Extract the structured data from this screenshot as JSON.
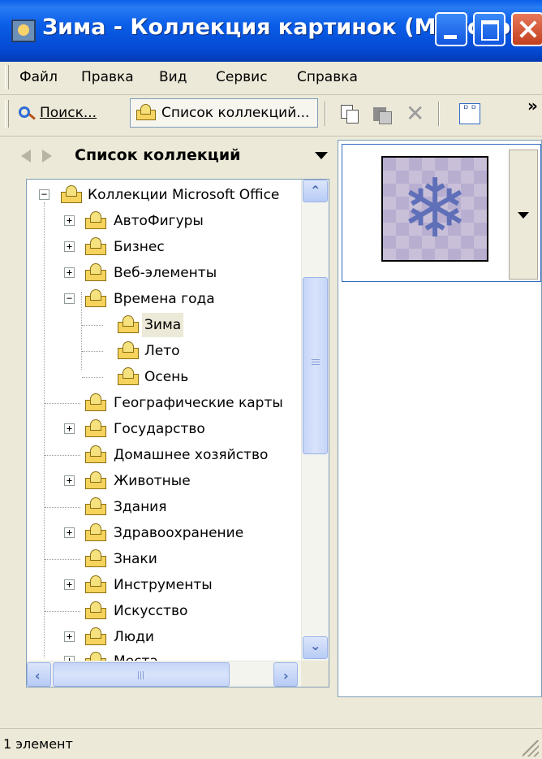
{
  "window": {
    "title": "Зима - Коллекция картинок (Microsoft)"
  },
  "menu": [
    {
      "label": "Файл"
    },
    {
      "label": "Правка"
    },
    {
      "label": "Вид"
    },
    {
      "label": "Сервис"
    },
    {
      "label": "Справка"
    }
  ],
  "toolbar": {
    "search_label": "Поиск...",
    "collection_list_label": "Список коллекций...",
    "more_chevron": "»",
    "layout_icon_text": "ᴰ ᴰ"
  },
  "left_pane": {
    "title": "Список коллекций",
    "tree": [
      {
        "label": "Коллекции Microsoft Office",
        "expander": "−"
      },
      {
        "label": "АвтоФигуры",
        "expander": "+"
      },
      {
        "label": "Бизнес",
        "expander": "+"
      },
      {
        "label": "Веб-элементы",
        "expander": "+"
      },
      {
        "label": "Времена года",
        "expander": "−"
      },
      {
        "label": "Зима",
        "expander": ""
      },
      {
        "label": "Лето",
        "expander": ""
      },
      {
        "label": "Осень",
        "expander": ""
      },
      {
        "label": "Географические карты",
        "expander": ""
      },
      {
        "label": "Государство",
        "expander": "+"
      },
      {
        "label": "Домашнее хозяйство",
        "expander": ""
      },
      {
        "label": "Животные",
        "expander": "+"
      },
      {
        "label": "Здания",
        "expander": ""
      },
      {
        "label": "Здравоохранение",
        "expander": "+"
      },
      {
        "label": "Знаки",
        "expander": ""
      },
      {
        "label": "Инструменты",
        "expander": "+"
      },
      {
        "label": "Искусство",
        "expander": ""
      },
      {
        "label": "Люди",
        "expander": "+"
      },
      {
        "label": "Места",
        "expander": "+"
      }
    ],
    "selected": "Зима"
  },
  "preview": {
    "flake_glyph": "❄"
  },
  "status": {
    "text": "1 элемент"
  },
  "colors": {
    "titlebar": "#0a5ee8",
    "close_button": "#d3582f",
    "chrome": "#ece9d8",
    "selection_border": "#316ac5"
  }
}
